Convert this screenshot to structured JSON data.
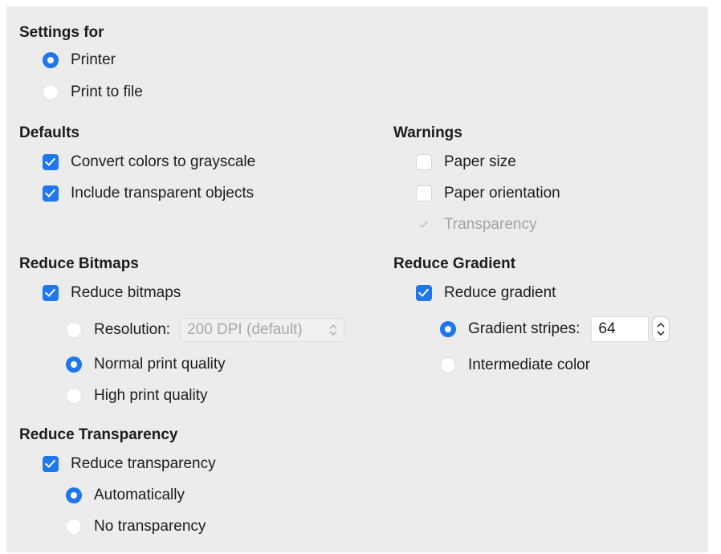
{
  "settings_for": {
    "title": "Settings for",
    "printer": "Printer",
    "print_to_file": "Print to file"
  },
  "defaults": {
    "title": "Defaults",
    "convert_grayscale": "Convert colors to grayscale",
    "include_transparent": "Include transparent objects"
  },
  "warnings": {
    "title": "Warnings",
    "paper_size": "Paper size",
    "paper_orientation": "Paper orientation",
    "transparency": "Transparency"
  },
  "reduce_bitmaps": {
    "title": "Reduce Bitmaps",
    "reduce_bitmaps": "Reduce bitmaps",
    "resolution": "Resolution:",
    "resolution_value": "200 DPI (default)",
    "normal_quality": "Normal print quality",
    "high_quality": "High print quality"
  },
  "reduce_gradient": {
    "title": "Reduce Gradient",
    "reduce_gradient": "Reduce gradient",
    "gradient_stripes": "Gradient stripes:",
    "gradient_stripes_value": "64",
    "intermediate_color": "Intermediate color"
  },
  "reduce_transparency": {
    "title": "Reduce Transparency",
    "reduce_transparency": "Reduce transparency",
    "automatically": "Automatically",
    "no_transparency": "No transparency"
  },
  "colors": {
    "accent": "#1e77ec",
    "panel_background": "#ececec",
    "disabled_text": "#a3a3a3"
  },
  "icons": {
    "checkbox_checked": "checkmark-icon",
    "radio_selected": "radio-dot-icon",
    "dropdown": "updown-chevron-icon",
    "stepper": "up-down-arrow-icon"
  }
}
